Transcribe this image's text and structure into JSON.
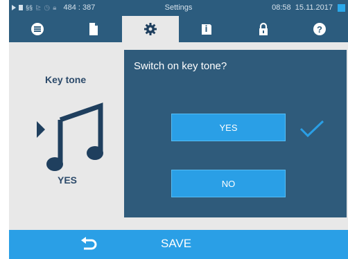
{
  "status_bar": {
    "coordinates": "484 : 387",
    "title": "Settings",
    "time": "08:58",
    "date": "15.11.2017",
    "icons": [
      "play-icon",
      "document-icon",
      "steam-icon",
      "chart-icon",
      "clock-icon",
      "lock-icon"
    ],
    "usb_color": "#2aa8ea"
  },
  "tabs": [
    {
      "icon": "list-icon",
      "active": false
    },
    {
      "icon": "document-icon",
      "active": false
    },
    {
      "icon": "gear-icon",
      "active": true
    },
    {
      "icon": "info-book-icon",
      "active": false
    },
    {
      "icon": "lock-icon",
      "active": false
    },
    {
      "icon": "help-icon",
      "active": false
    }
  ],
  "setting": {
    "title": "Key tone",
    "icon": "music-note-icon",
    "current_value": "YES"
  },
  "dialog": {
    "question": "Switch on key tone?",
    "yes_label": "YES",
    "no_label": "NO",
    "selected": "YES"
  },
  "footer": {
    "back_icon": "back-arrow-icon",
    "save_label": "SAVE"
  },
  "colors": {
    "header": "#2c5c7e",
    "accent": "#2a9fe6",
    "dialog": "#2f5b7b",
    "background": "#e8e8e8"
  }
}
